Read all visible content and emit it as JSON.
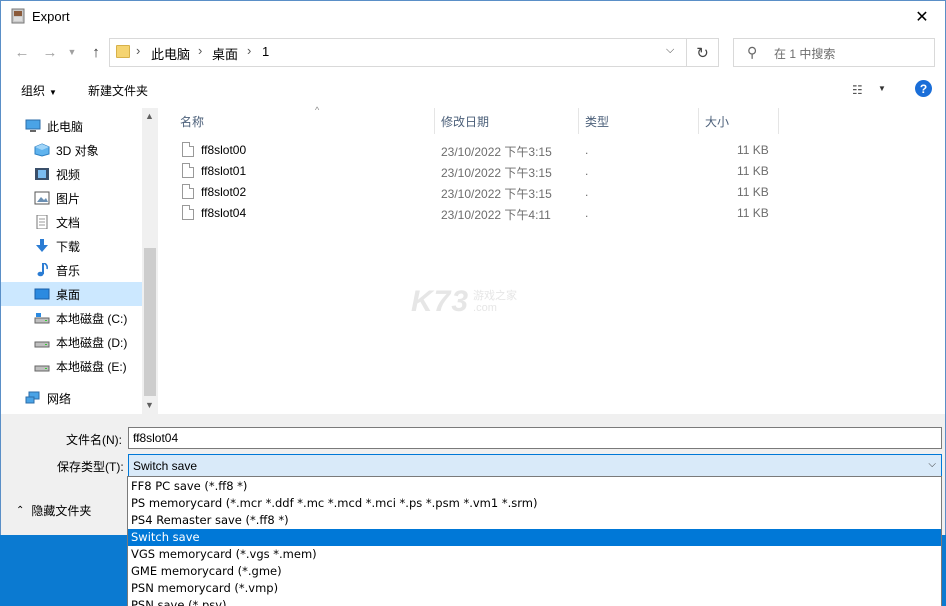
{
  "window": {
    "title": "Export"
  },
  "address": {
    "crumbs": [
      "此电脑",
      "桌面",
      "1"
    ],
    "search_placeholder": "在 1 中搜索"
  },
  "toolbar": {
    "organize": "组织",
    "new_folder": "新建文件夹"
  },
  "navpane": {
    "items": [
      {
        "label": "此电脑",
        "icon": "computer-icon"
      },
      {
        "label": "3D 对象",
        "icon": "3d-objects-icon"
      },
      {
        "label": "视频",
        "icon": "video-icon"
      },
      {
        "label": "图片",
        "icon": "pictures-icon"
      },
      {
        "label": "文档",
        "icon": "documents-icon"
      },
      {
        "label": "下载",
        "icon": "download-icon"
      },
      {
        "label": "音乐",
        "icon": "music-icon"
      },
      {
        "label": "桌面",
        "icon": "desktop-icon",
        "selected": true
      },
      {
        "label": "本地磁盘 (C:)",
        "icon": "drive-icon"
      },
      {
        "label": "本地磁盘 (D:)",
        "icon": "drive-icon"
      },
      {
        "label": "本地磁盘 (E:)",
        "icon": "drive-icon"
      },
      {
        "label": "网络",
        "icon": "network-icon"
      }
    ]
  },
  "filelist": {
    "columns": [
      "名称",
      "修改日期",
      "类型",
      "大小"
    ],
    "rows": [
      {
        "name": "ff8slot00",
        "date": "23/10/2022 下午3:15",
        "type": ".",
        "size": "11 KB"
      },
      {
        "name": "ff8slot01",
        "date": "23/10/2022 下午3:15",
        "type": ".",
        "size": "11 KB"
      },
      {
        "name": "ff8slot02",
        "date": "23/10/2022 下午3:15",
        "type": ".",
        "size": "11 KB"
      },
      {
        "name": "ff8slot04",
        "date": "23/10/2022 下午4:11",
        "type": ".",
        "size": "11 KB"
      }
    ]
  },
  "watermark": {
    "big": "K73",
    "small_top": "游戏之家",
    "small_bottom": ".com"
  },
  "bottom": {
    "filename_label": "文件名(N):",
    "filename_value": "ff8slot04",
    "filetype_label": "保存类型(T):",
    "filetype_value": "Switch save",
    "hide_folders": "隐藏文件夹"
  },
  "dropdown": {
    "options": [
      "FF8 PC save (*.ff8 *)",
      "PS memorycard (*.mcr *.ddf *.mc *.mcd *.mci *.ps *.psm *.vm1 *.srm)",
      "PS4 Remaster save (*.ff8 *)",
      "Switch save",
      "VGS memorycard (*.vgs *.mem)",
      "GME memorycard (*.gme)",
      "PSN memorycard (*.vmp)",
      "PSN save (*.psv)"
    ],
    "selected_index": 3
  },
  "colors": {
    "accent": "#0078d7",
    "selection_bg": "#cce8ff",
    "desktop_bg": "#0b7ad1"
  }
}
